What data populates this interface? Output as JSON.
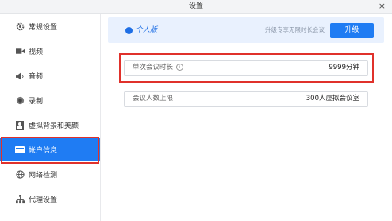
{
  "window": {
    "title": "设置",
    "close_glyph": "×"
  },
  "sidebar": {
    "items": [
      {
        "label": "常规设置",
        "icon": "gear-icon"
      },
      {
        "label": "视频",
        "icon": "video-camera-icon"
      },
      {
        "label": "音频",
        "icon": "speaker-icon"
      },
      {
        "label": "录制",
        "icon": "record-icon"
      },
      {
        "label": "虚拟背景和美颜",
        "icon": "portrait-icon"
      },
      {
        "label": "帐户信息",
        "icon": "id-card-icon",
        "active": true
      },
      {
        "label": "网络检测",
        "icon": "globe-icon"
      },
      {
        "label": "代理设置",
        "icon": "network-tree-icon"
      }
    ]
  },
  "banner": {
    "account_type": "个人版",
    "hint": "升级专享无限时长会议",
    "upgrade_label": "升级"
  },
  "fields": [
    {
      "label": "单次会议时长",
      "value": "9999分钟",
      "has_info": true
    },
    {
      "label": "会议人数上限",
      "value": "300人虚拟会议室",
      "has_info": false
    }
  ],
  "colors": {
    "accent": "#1f7cf3",
    "highlight": "#e0312b",
    "banner_bg": "#e9f1fe"
  }
}
